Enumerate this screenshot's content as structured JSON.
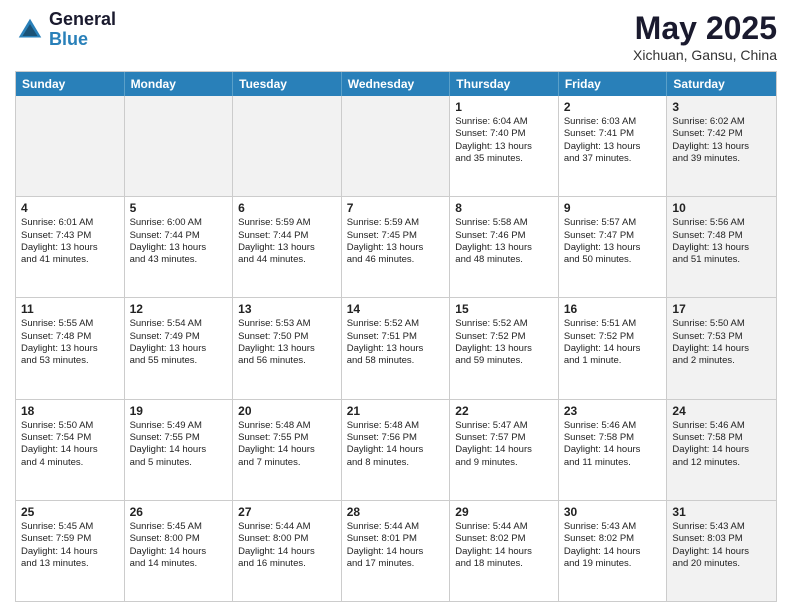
{
  "logo": {
    "general": "General",
    "blue": "Blue"
  },
  "title": "May 2025",
  "subtitle": "Xichuan, Gansu, China",
  "headers": [
    "Sunday",
    "Monday",
    "Tuesday",
    "Wednesday",
    "Thursday",
    "Friday",
    "Saturday"
  ],
  "rows": [
    [
      {
        "day": "",
        "shaded": true,
        "lines": []
      },
      {
        "day": "",
        "shaded": true,
        "lines": []
      },
      {
        "day": "",
        "shaded": true,
        "lines": []
      },
      {
        "day": "",
        "shaded": true,
        "lines": []
      },
      {
        "day": "1",
        "shaded": false,
        "lines": [
          "Sunrise: 6:04 AM",
          "Sunset: 7:40 PM",
          "Daylight: 13 hours",
          "and 35 minutes."
        ]
      },
      {
        "day": "2",
        "shaded": false,
        "lines": [
          "Sunrise: 6:03 AM",
          "Sunset: 7:41 PM",
          "Daylight: 13 hours",
          "and 37 minutes."
        ]
      },
      {
        "day": "3",
        "shaded": true,
        "lines": [
          "Sunrise: 6:02 AM",
          "Sunset: 7:42 PM",
          "Daylight: 13 hours",
          "and 39 minutes."
        ]
      }
    ],
    [
      {
        "day": "4",
        "shaded": false,
        "lines": [
          "Sunrise: 6:01 AM",
          "Sunset: 7:43 PM",
          "Daylight: 13 hours",
          "and 41 minutes."
        ]
      },
      {
        "day": "5",
        "shaded": false,
        "lines": [
          "Sunrise: 6:00 AM",
          "Sunset: 7:44 PM",
          "Daylight: 13 hours",
          "and 43 minutes."
        ]
      },
      {
        "day": "6",
        "shaded": false,
        "lines": [
          "Sunrise: 5:59 AM",
          "Sunset: 7:44 PM",
          "Daylight: 13 hours",
          "and 44 minutes."
        ]
      },
      {
        "day": "7",
        "shaded": false,
        "lines": [
          "Sunrise: 5:59 AM",
          "Sunset: 7:45 PM",
          "Daylight: 13 hours",
          "and 46 minutes."
        ]
      },
      {
        "day": "8",
        "shaded": false,
        "lines": [
          "Sunrise: 5:58 AM",
          "Sunset: 7:46 PM",
          "Daylight: 13 hours",
          "and 48 minutes."
        ]
      },
      {
        "day": "9",
        "shaded": false,
        "lines": [
          "Sunrise: 5:57 AM",
          "Sunset: 7:47 PM",
          "Daylight: 13 hours",
          "and 50 minutes."
        ]
      },
      {
        "day": "10",
        "shaded": true,
        "lines": [
          "Sunrise: 5:56 AM",
          "Sunset: 7:48 PM",
          "Daylight: 13 hours",
          "and 51 minutes."
        ]
      }
    ],
    [
      {
        "day": "11",
        "shaded": false,
        "lines": [
          "Sunrise: 5:55 AM",
          "Sunset: 7:48 PM",
          "Daylight: 13 hours",
          "and 53 minutes."
        ]
      },
      {
        "day": "12",
        "shaded": false,
        "lines": [
          "Sunrise: 5:54 AM",
          "Sunset: 7:49 PM",
          "Daylight: 13 hours",
          "and 55 minutes."
        ]
      },
      {
        "day": "13",
        "shaded": false,
        "lines": [
          "Sunrise: 5:53 AM",
          "Sunset: 7:50 PM",
          "Daylight: 13 hours",
          "and 56 minutes."
        ]
      },
      {
        "day": "14",
        "shaded": false,
        "lines": [
          "Sunrise: 5:52 AM",
          "Sunset: 7:51 PM",
          "Daylight: 13 hours",
          "and 58 minutes."
        ]
      },
      {
        "day": "15",
        "shaded": false,
        "lines": [
          "Sunrise: 5:52 AM",
          "Sunset: 7:52 PM",
          "Daylight: 13 hours",
          "and 59 minutes."
        ]
      },
      {
        "day": "16",
        "shaded": false,
        "lines": [
          "Sunrise: 5:51 AM",
          "Sunset: 7:52 PM",
          "Daylight: 14 hours",
          "and 1 minute."
        ]
      },
      {
        "day": "17",
        "shaded": true,
        "lines": [
          "Sunrise: 5:50 AM",
          "Sunset: 7:53 PM",
          "Daylight: 14 hours",
          "and 2 minutes."
        ]
      }
    ],
    [
      {
        "day": "18",
        "shaded": false,
        "lines": [
          "Sunrise: 5:50 AM",
          "Sunset: 7:54 PM",
          "Daylight: 14 hours",
          "and 4 minutes."
        ]
      },
      {
        "day": "19",
        "shaded": false,
        "lines": [
          "Sunrise: 5:49 AM",
          "Sunset: 7:55 PM",
          "Daylight: 14 hours",
          "and 5 minutes."
        ]
      },
      {
        "day": "20",
        "shaded": false,
        "lines": [
          "Sunrise: 5:48 AM",
          "Sunset: 7:55 PM",
          "Daylight: 14 hours",
          "and 7 minutes."
        ]
      },
      {
        "day": "21",
        "shaded": false,
        "lines": [
          "Sunrise: 5:48 AM",
          "Sunset: 7:56 PM",
          "Daylight: 14 hours",
          "and 8 minutes."
        ]
      },
      {
        "day": "22",
        "shaded": false,
        "lines": [
          "Sunrise: 5:47 AM",
          "Sunset: 7:57 PM",
          "Daylight: 14 hours",
          "and 9 minutes."
        ]
      },
      {
        "day": "23",
        "shaded": false,
        "lines": [
          "Sunrise: 5:46 AM",
          "Sunset: 7:58 PM",
          "Daylight: 14 hours",
          "and 11 minutes."
        ]
      },
      {
        "day": "24",
        "shaded": true,
        "lines": [
          "Sunrise: 5:46 AM",
          "Sunset: 7:58 PM",
          "Daylight: 14 hours",
          "and 12 minutes."
        ]
      }
    ],
    [
      {
        "day": "25",
        "shaded": false,
        "lines": [
          "Sunrise: 5:45 AM",
          "Sunset: 7:59 PM",
          "Daylight: 14 hours",
          "and 13 minutes."
        ]
      },
      {
        "day": "26",
        "shaded": false,
        "lines": [
          "Sunrise: 5:45 AM",
          "Sunset: 8:00 PM",
          "Daylight: 14 hours",
          "and 14 minutes."
        ]
      },
      {
        "day": "27",
        "shaded": false,
        "lines": [
          "Sunrise: 5:44 AM",
          "Sunset: 8:00 PM",
          "Daylight: 14 hours",
          "and 16 minutes."
        ]
      },
      {
        "day": "28",
        "shaded": false,
        "lines": [
          "Sunrise: 5:44 AM",
          "Sunset: 8:01 PM",
          "Daylight: 14 hours",
          "and 17 minutes."
        ]
      },
      {
        "day": "29",
        "shaded": false,
        "lines": [
          "Sunrise: 5:44 AM",
          "Sunset: 8:02 PM",
          "Daylight: 14 hours",
          "and 18 minutes."
        ]
      },
      {
        "day": "30",
        "shaded": false,
        "lines": [
          "Sunrise: 5:43 AM",
          "Sunset: 8:02 PM",
          "Daylight: 14 hours",
          "and 19 minutes."
        ]
      },
      {
        "day": "31",
        "shaded": true,
        "lines": [
          "Sunrise: 5:43 AM",
          "Sunset: 8:03 PM",
          "Daylight: 14 hours",
          "and 20 minutes."
        ]
      }
    ]
  ]
}
